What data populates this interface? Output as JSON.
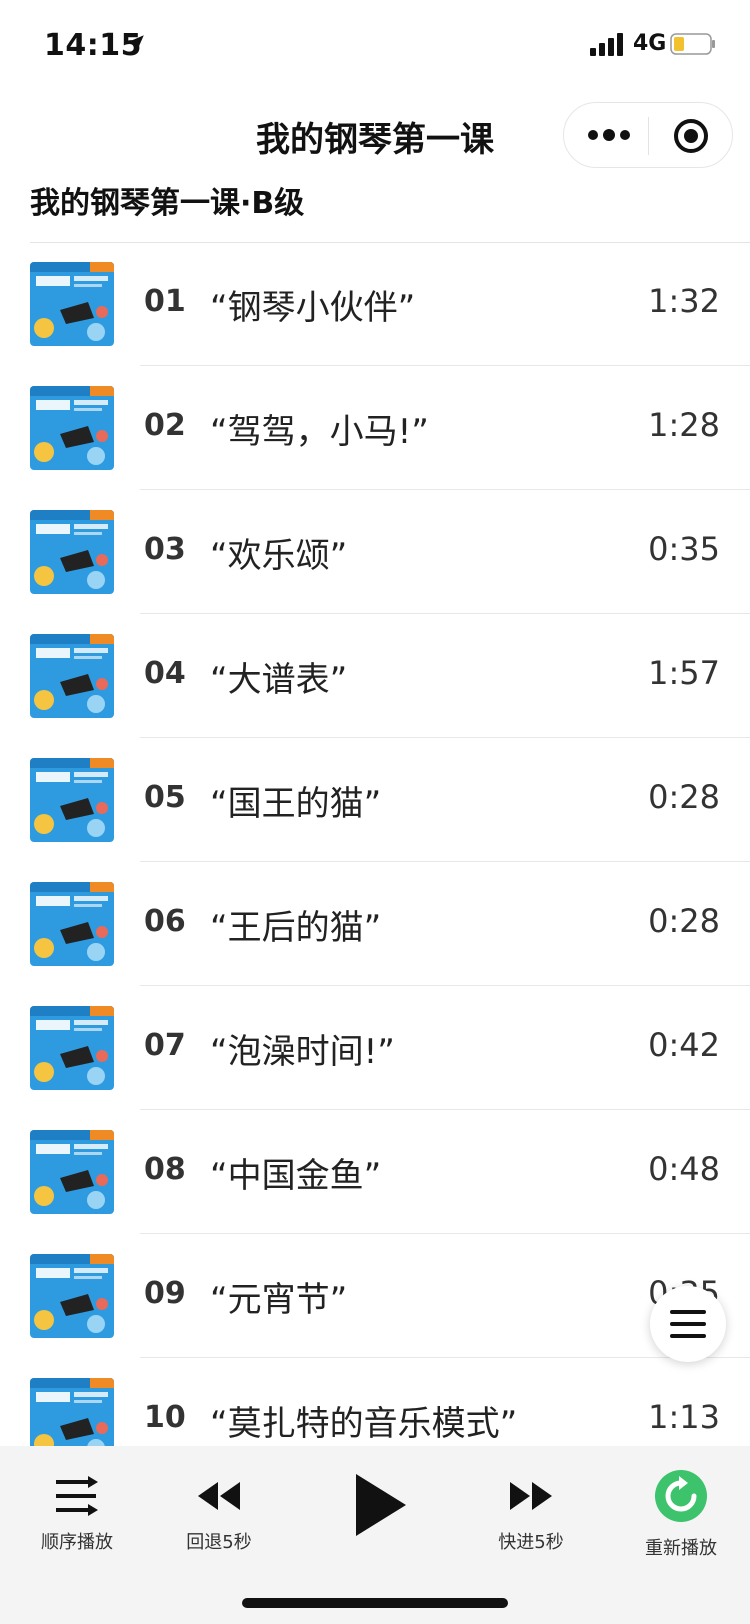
{
  "status_bar": {
    "time": "14:15",
    "network": "4G"
  },
  "nav": {
    "title": "我的钢琴第一课"
  },
  "subtitle": "我的钢琴第一课·B级",
  "tracks": [
    {
      "num": "01",
      "title": "“钢琴小伙伴”",
      "duration": "1:32"
    },
    {
      "num": "02",
      "title": "“驾驾，小马!”",
      "duration": "1:28"
    },
    {
      "num": "03",
      "title": "“欢乐颂”",
      "duration": "0:35"
    },
    {
      "num": "04",
      "title": "“大谱表”",
      "duration": "1:57"
    },
    {
      "num": "05",
      "title": "“国王的猫”",
      "duration": "0:28"
    },
    {
      "num": "06",
      "title": "“王后的猫”",
      "duration": "0:28"
    },
    {
      "num": "07",
      "title": "“泡澡时间!”",
      "duration": "0:42"
    },
    {
      "num": "08",
      "title": "“中国金鱼”",
      "duration": "0:48"
    },
    {
      "num": "09",
      "title": "“元宵节”",
      "duration": "0:35"
    },
    {
      "num": "10",
      "title": "“莫扎特的音乐模式”",
      "duration": "1:13"
    }
  ],
  "controls": {
    "order_label": "顺序播放",
    "rewind_label": "回退5秒",
    "forward_label": "快进5秒",
    "replay_label": "重新播放"
  },
  "colors": {
    "accent": "#3cc36b",
    "thumb_bg": "#2e9be0"
  },
  "icons": [
    "location-arrow-icon",
    "signal-icon",
    "battery-icon",
    "more-dots-icon",
    "target-icon",
    "menu-icon",
    "order-play-icon",
    "rewind-icon",
    "play-icon",
    "fast-forward-icon",
    "replay-icon"
  ]
}
